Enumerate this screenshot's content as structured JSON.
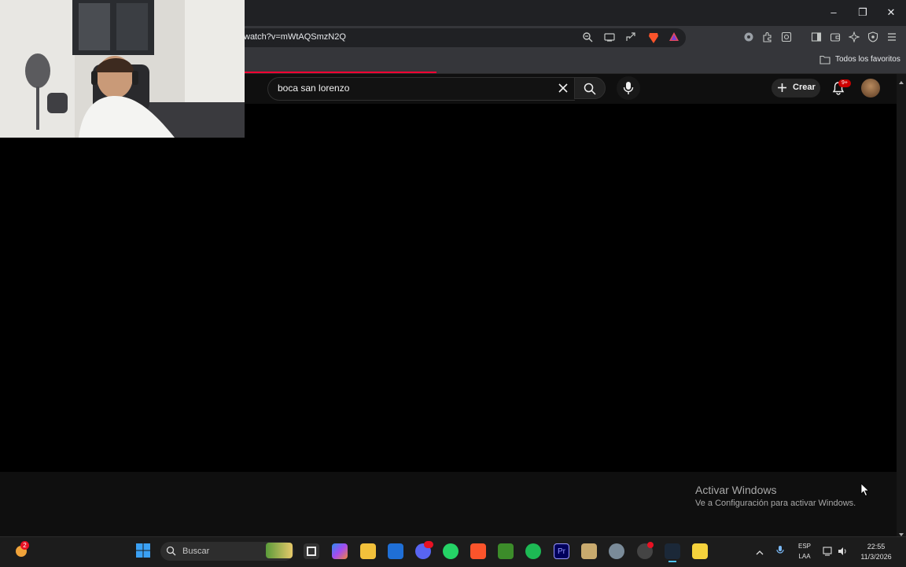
{
  "browser": {
    "url": "watch?v=mWtAQSmzN2Q",
    "bookmarks_folder": "Todos los favoritos",
    "window_controls": {
      "minimize": "–",
      "restore": "❐",
      "close": "✕"
    }
  },
  "youtube": {
    "search": {
      "query": "boca san lorenzo"
    },
    "create_label": "Crear",
    "notifications_badge": "9+"
  },
  "watermark": {
    "title": "Activar Windows",
    "subtitle": "Ve a Configuración para activar Windows."
  },
  "taskbar": {
    "notification_count": "2",
    "search_placeholder": "Buscar",
    "language_top": "ESP",
    "language_bottom": "LAA",
    "time": "22:55",
    "date": "11/3/2026",
    "colors": {
      "steam_underline": "#4cc2ff",
      "red_badge": "#e81123"
    }
  }
}
